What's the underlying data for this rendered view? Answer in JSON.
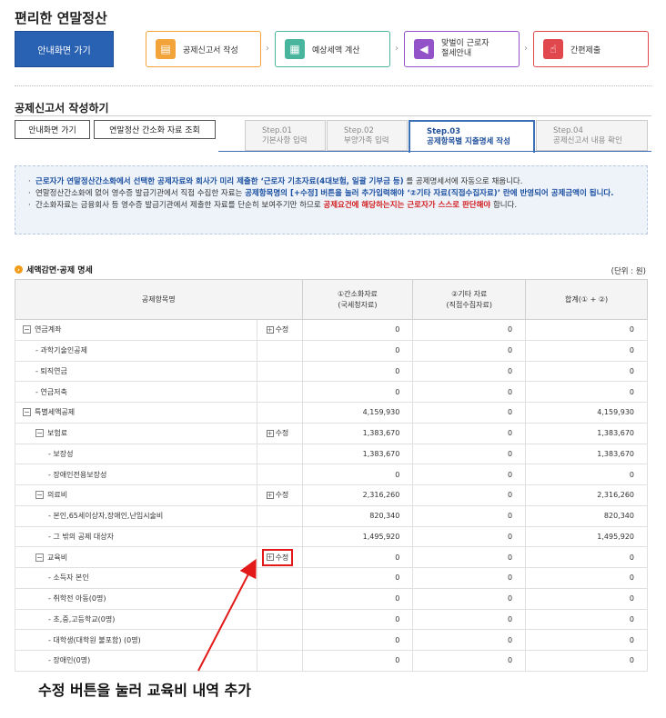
{
  "title": "편리한 연말정산",
  "guide_button": "안내화면 가기",
  "steps": [
    {
      "label": "공제신고서 작성",
      "color": "#f2a33a"
    },
    {
      "label": "예상세액 계산",
      "color": "#48b59c"
    },
    {
      "label": "맞벌이 근로자\n절세안내",
      "color": "#9353c8"
    },
    {
      "label": "간편제출",
      "color": "#e0484e"
    }
  ],
  "section_title": "공제신고서 작성하기",
  "buttons": {
    "guide": "안내화면 가기",
    "view": "연말정산 간소화 자료 조회"
  },
  "tabs": [
    {
      "step": "Step.01",
      "label": "기본사항 입력"
    },
    {
      "step": "Step.02",
      "label": "부양가족 입력"
    },
    {
      "step": "Step.03",
      "label": "공제항목별 지출명세 작성"
    },
    {
      "step": "Step.04",
      "label": "공제신고서 내용 확인"
    }
  ],
  "notice": {
    "line1_a": "근로자가 연말정산간소화에서 선택한 공제자료와 회사가 미리 제출한 ‘근로자 기초자료(4대보험, 일괄 기부금 등)",
    "line1_b": "를 공제명세서에 자동으로 채웁니다.",
    "line2_a": "연말정산간소화에 없어 영수증 발급기관에서 직접 수집한 자료는",
    "line2_b": "공제항목명의 [+수정] 버튼을 눌러 추가입력해야 ‘②기타 자료(직접수집자료)’ 란에 반영되어 공제금액이 됩니다.",
    "line3_a": "간소화자료는 금융회사 등 영수증 발급기관에서 제출한 자료를 단순히 보여주기만 하므로",
    "line3_b": "공제요건에 해당하는지는 근로자가 스스로 판단해야",
    "line3_c": "합니다."
  },
  "table_title": "세액감면·공제 명세",
  "unit": "(단위 : 원)",
  "headers": [
    "공제항목명",
    "①간소화자료\n(국세청자료)",
    "②기타 자료\n(직접수집자료)",
    "합계(① + ②)"
  ],
  "edit_label": "수정",
  "rows": [
    {
      "name": "연금계좌",
      "level": 0,
      "toggle": "−",
      "edit": true,
      "a": "0",
      "b": "0",
      "sum": "0"
    },
    {
      "name": "- 과학기술인공제",
      "level": 1,
      "toggle": "",
      "edit": false,
      "a": "0",
      "b": "0",
      "sum": "0"
    },
    {
      "name": "- 퇴직연금",
      "level": 1,
      "toggle": "",
      "edit": false,
      "a": "0",
      "b": "0",
      "sum": "0"
    },
    {
      "name": "- 연금저축",
      "level": 1,
      "toggle": "",
      "edit": false,
      "a": "0",
      "b": "0",
      "sum": "0"
    },
    {
      "name": "특별세액공제",
      "level": 0,
      "toggle": "−",
      "edit": false,
      "a": "4,159,930",
      "b": "0",
      "sum": "4,159,930"
    },
    {
      "name": "보험료",
      "level": 1,
      "toggle": "−",
      "edit": true,
      "a": "1,383,670",
      "b": "0",
      "sum": "1,383,670"
    },
    {
      "name": "- 보장성",
      "level": 2,
      "toggle": "",
      "edit": false,
      "a": "1,383,670",
      "b": "0",
      "sum": "1,383,670"
    },
    {
      "name": "- 장애인전용보장성",
      "level": 2,
      "toggle": "",
      "edit": false,
      "a": "0",
      "b": "0",
      "sum": "0"
    },
    {
      "name": "의료비",
      "level": 1,
      "toggle": "−",
      "edit": true,
      "a": "2,316,260",
      "b": "0",
      "sum": "2,316,260"
    },
    {
      "name": "- 본인,65세이상자,장애인,난임시술비",
      "level": 2,
      "toggle": "",
      "edit": false,
      "a": "820,340",
      "b": "0",
      "sum": "820,340"
    },
    {
      "name": "- 그 밖의 공제 대상자",
      "level": 2,
      "toggle": "",
      "edit": false,
      "a": "1,495,920",
      "b": "0",
      "sum": "1,495,920"
    },
    {
      "name": "교육비",
      "level": 1,
      "toggle": "−",
      "edit": true,
      "highlight": true,
      "a": "0",
      "b": "0",
      "sum": "0"
    },
    {
      "name": "- 소득자 본인",
      "level": 2,
      "toggle": "",
      "edit": false,
      "a": "0",
      "b": "0",
      "sum": "0"
    },
    {
      "name": "- 취학전 아동(0명)",
      "level": 2,
      "toggle": "",
      "edit": false,
      "a": "0",
      "b": "0",
      "sum": "0"
    },
    {
      "name": "- 초,중,고등학교(0명)",
      "level": 2,
      "toggle": "",
      "edit": false,
      "a": "0",
      "b": "0",
      "sum": "0"
    },
    {
      "name": "- 대학생(대학원 불포함) (0명)",
      "level": 2,
      "toggle": "",
      "edit": false,
      "a": "0",
      "b": "0",
      "sum": "0"
    },
    {
      "name": "- 장애인(0명)",
      "level": 2,
      "toggle": "",
      "edit": false,
      "a": "0",
      "b": "0",
      "sum": "0"
    }
  ],
  "annotation": "수정 버튼을 눌러 교육비 내역 추가",
  "colors": {
    "accent": "#2a62b3",
    "highlight": "#e31919"
  }
}
